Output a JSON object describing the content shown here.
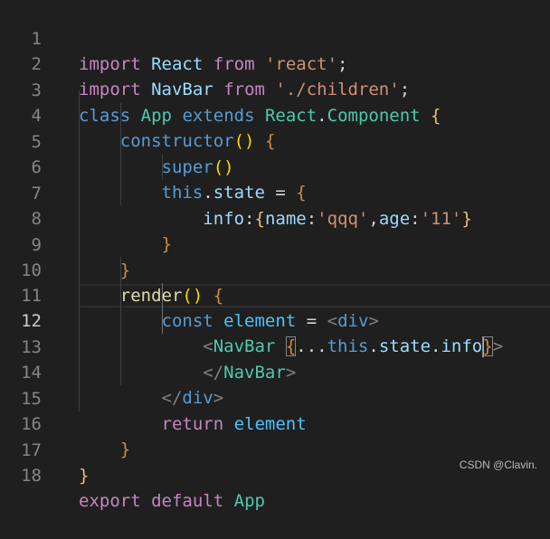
{
  "editor": {
    "active_line": 12,
    "line_numbers": [
      "1",
      "2",
      "3",
      "4",
      "5",
      "6",
      "7",
      "8",
      "9",
      "10",
      "11",
      "12",
      "13",
      "14",
      "15",
      "16",
      "17",
      "18"
    ],
    "lines": {
      "l1": {
        "t0": "import",
        "t1": "React",
        "t2": "from",
        "t3": "'react'",
        "t4": ";"
      },
      "l2": {
        "t0": "import",
        "t1": "NavBar",
        "t2": "from",
        "t3": "'./children'",
        "t4": ";"
      },
      "l3": {
        "t0": "class",
        "t1": "App",
        "t2": "extends",
        "t3": "React",
        "t4": ".",
        "t5": "Component",
        "t6": "{"
      },
      "l4": {
        "t0": "constructor",
        "t1": "()",
        "t2": "{"
      },
      "l5": {
        "t0": "super",
        "t1": "()"
      },
      "l6": {
        "t0": "this",
        "t1": ".",
        "t2": "state",
        "t3": "=",
        "t4": "{"
      },
      "l7": {
        "t0": "info",
        "t1": ":",
        "t2": "{",
        "t3": "name",
        "t4": ":",
        "t5": "'qqq'",
        "t6": ",",
        "t7": "age",
        "t8": ":",
        "t9": "'11'",
        "t10": "}"
      },
      "l8": {
        "t0": "}"
      },
      "l9": {
        "t0": "}"
      },
      "l10": {
        "t0": "render",
        "t1": "()",
        "t2": "{"
      },
      "l11": {
        "t0": "const",
        "t1": "element",
        "t2": "=",
        "t3": "<",
        "t4": "div",
        "t5": ">"
      },
      "l12": {
        "t0": "<",
        "t1": "NavBar",
        "t2": "{",
        "t3": "...",
        "t4": "this",
        "t5": ".",
        "t6": "state",
        "t7": ".",
        "t8": "info",
        "t9": "}",
        "t10": ">"
      },
      "l13": {
        "t0": "</",
        "t1": "NavBar",
        "t2": ">"
      },
      "l14": {
        "t0": "</",
        "t1": "div",
        "t2": ">"
      },
      "l15": {
        "t0": "return",
        "t1": "element"
      },
      "l16": {
        "t0": "}"
      },
      "l17": {
        "t0": "}"
      },
      "l18": {
        "t0": "export",
        "t1": "default",
        "t2": "App"
      }
    }
  },
  "watermark": "CSDN @Clavin."
}
